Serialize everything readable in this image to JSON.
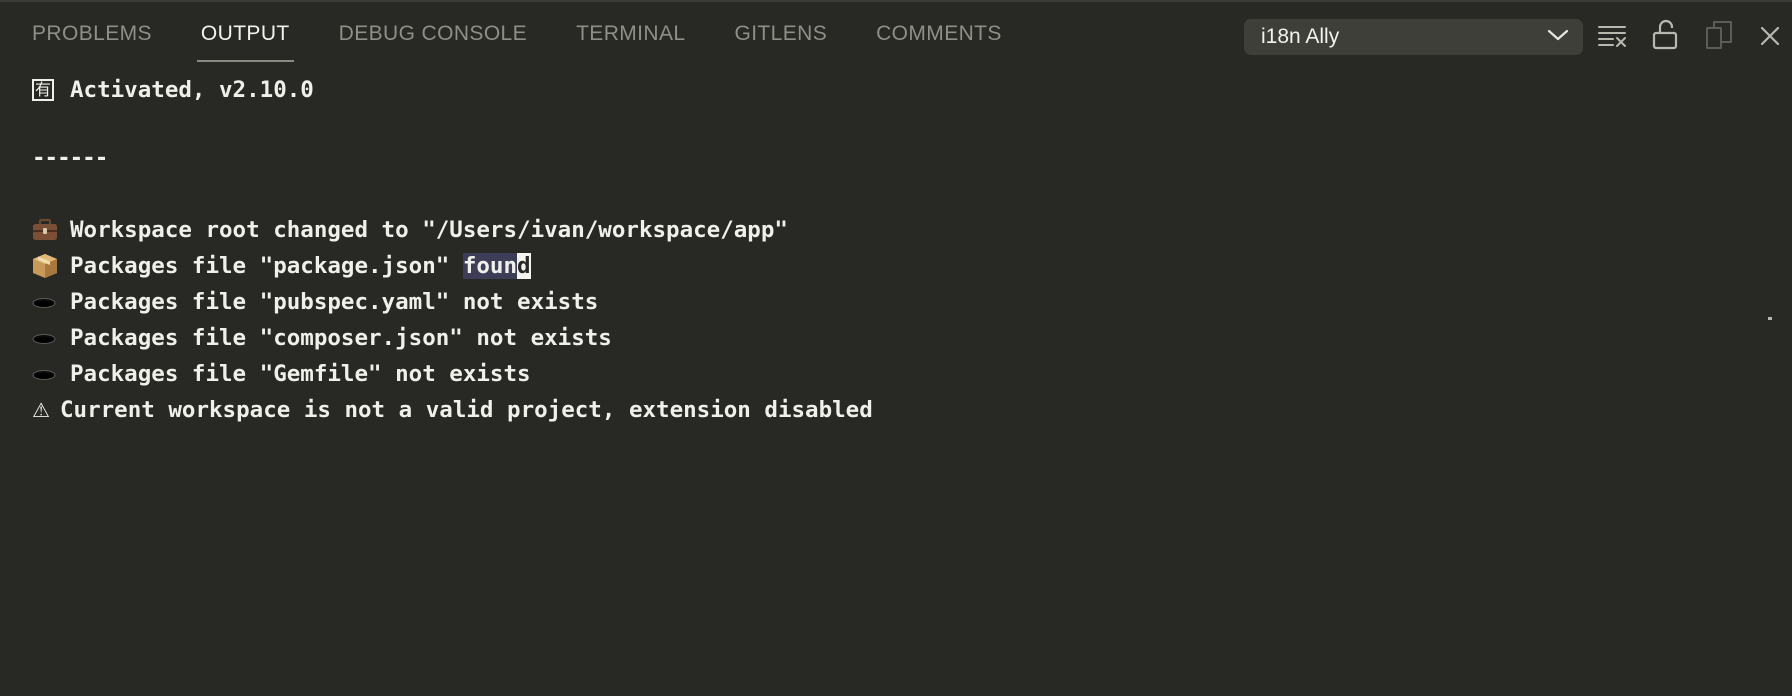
{
  "tabs": [
    {
      "label": "PROBLEMS",
      "active": false
    },
    {
      "label": "OUTPUT",
      "active": true
    },
    {
      "label": "DEBUG CONSOLE",
      "active": false
    },
    {
      "label": "TERMINAL",
      "active": false
    },
    {
      "label": "GITLENS",
      "active": false
    },
    {
      "label": "COMMENTS",
      "active": false
    }
  ],
  "channel_select": {
    "selected": "i18n Ally",
    "icon": "chevron-down-icon"
  },
  "actions": [
    {
      "name": "clear-output-icon"
    },
    {
      "name": "unlock-icon"
    },
    {
      "name": "copy-icon"
    },
    {
      "name": "close-icon"
    }
  ],
  "output": {
    "activated": {
      "icon": "kanji-badge-icon",
      "glyph": "有",
      "text": "Activated, v2.10.0"
    },
    "separator": "------",
    "workspace": {
      "icon": "briefcase-icon",
      "text": "Workspace root changed to \"/Users/ivan/workspace/app\""
    },
    "pkg_json": {
      "icon": "package-icon",
      "prefix": "Packages file \"package.json\" ",
      "highlight": "foun",
      "cursor": "d"
    },
    "pubspec": {
      "icon": "hole-icon",
      "text": "Packages file \"pubspec.yaml\" not exists"
    },
    "composer": {
      "icon": "hole-icon",
      "text": "Packages file \"composer.json\" not exists"
    },
    "gemfile": {
      "icon": "hole-icon",
      "text": "Packages file \"Gemfile\" not exists"
    },
    "warning": {
      "icon": "warning-icon",
      "glyph": "⚠",
      "text": "Current workspace is not a valid project, extension disabled"
    }
  },
  "colors": {
    "background": "#282824",
    "text": "#f0f0ea",
    "tab_inactive": "#8f8f87",
    "selection": "#3d3d58",
    "select_bg": "#3f3f3a"
  }
}
